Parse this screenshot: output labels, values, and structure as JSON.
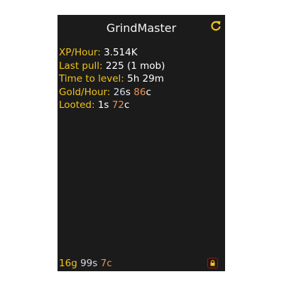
{
  "window": {
    "title": "GrindMaster"
  },
  "stats": {
    "xp_hour": {
      "label": "XP/Hour:",
      "value": "3.514K"
    },
    "last_pull": {
      "label": "Last pull:",
      "value": "225 (1 mob)"
    },
    "time_to_level": {
      "label": "Time to level:",
      "value": "5h 29m"
    },
    "gold_hour": {
      "label": "Gold/Hour:",
      "silver": "26",
      "silver_unit": "s",
      "copper": "86",
      "copper_unit": "c"
    },
    "looted": {
      "label": "Looted:",
      "silver": "1",
      "silver_unit": "s",
      "copper": "72",
      "copper_unit": "c"
    }
  },
  "footer": {
    "gold": "16",
    "gold_unit": "g",
    "silver": "99",
    "silver_unit": "s",
    "copper": "7",
    "copper_unit": "c"
  },
  "icons": {
    "refresh": "refresh-icon",
    "lock": "lock-icon"
  },
  "colors": {
    "background": "#1b1b1b",
    "label": "#f1c21b",
    "silver": "#d6dbe4",
    "copper": "#e8925a"
  }
}
